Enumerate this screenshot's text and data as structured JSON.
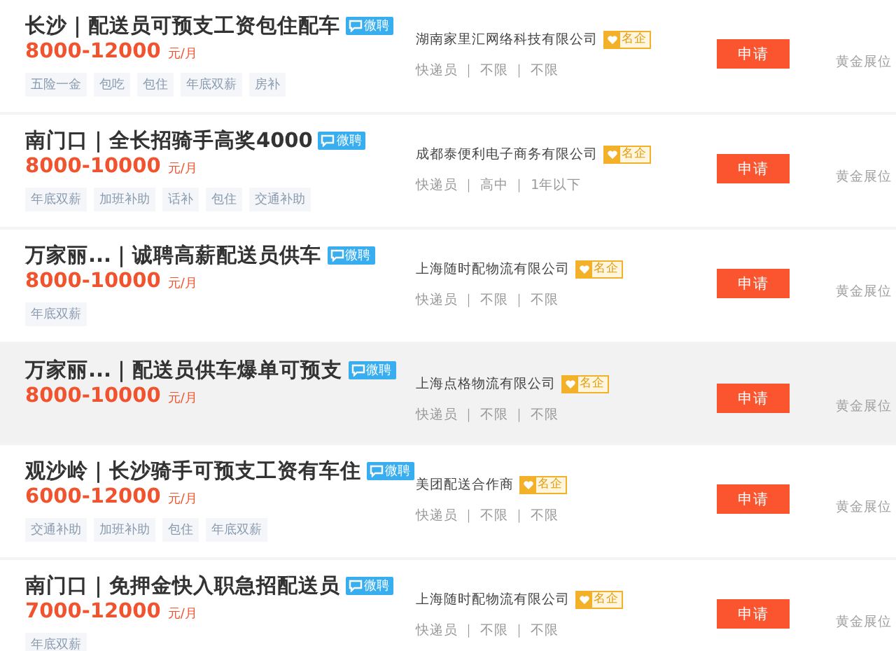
{
  "jobs": [
    {
      "title": "长沙｜配送员可预支工资包住配车",
      "badge": "微聘",
      "salary": "8000-12000",
      "unit": "元/月",
      "tags": [
        "五险一金",
        "包吃",
        "包住",
        "年底双薪",
        "房补"
      ],
      "company": "湖南家里汇网络科技有限公司",
      "company_badge": "名企",
      "requirements": "快递员 ｜ 不限 ｜ 不限",
      "button": "申请",
      "note": "黄金展位",
      "highlighted": false
    },
    {
      "title": "南门口｜全长招骑手高奖4000",
      "badge": "微聘",
      "salary": "8000-10000",
      "unit": "元/月",
      "tags": [
        "年底双薪",
        "加班补助",
        "话补",
        "包住",
        "交通补助"
      ],
      "company": "成都泰便利电子商务有限公司",
      "company_badge": "名企",
      "requirements": "快递员 ｜ 高中 ｜ 1年以下",
      "button": "申请",
      "note": "黄金展位",
      "highlighted": false
    },
    {
      "title": "万家丽...｜诚聘高薪配送员供车",
      "badge": "微聘",
      "salary": "8000-10000",
      "unit": "元/月",
      "tags": [
        "年底双薪"
      ],
      "company": "上海随时配物流有限公司",
      "company_badge": "名企",
      "requirements": "快递员 ｜ 不限 ｜ 不限",
      "button": "申请",
      "note": "黄金展位",
      "highlighted": false
    },
    {
      "title": "万家丽...｜配送员供车爆单可预支",
      "badge": "微聘",
      "salary": "8000-10000",
      "unit": "元/月",
      "company": "上海点格物流有限公司",
      "company_badge": "名企",
      "requirements": "快递员 ｜ 不限 ｜ 不限",
      "button": "申请",
      "note": "黄金展位",
      "highlighted": true
    },
    {
      "title": "观沙岭｜长沙骑手可预支工资有车住",
      "badge": "微聘",
      "salary": "6000-12000",
      "unit": "元/月",
      "tags": [
        "交通补助",
        "加班补助",
        "包住",
        "年底双薪"
      ],
      "company": "美团配送合作商",
      "company_badge": "名企",
      "requirements": "快递员 ｜ 不限 ｜ 不限",
      "button": "申请",
      "note": "黄金展位",
      "highlighted": false
    },
    {
      "title": "南门口｜免押金快入职急招配送员",
      "badge": "微聘",
      "salary": "7000-12000",
      "unit": "元/月",
      "tags": [
        "年底双薪"
      ],
      "company": "上海随时配物流有限公司",
      "company_badge": "名企",
      "requirements": "快递员 ｜ 不限 ｜ 不限",
      "button": "申请",
      "note": "黄金展位",
      "highlighted": false
    }
  ]
}
